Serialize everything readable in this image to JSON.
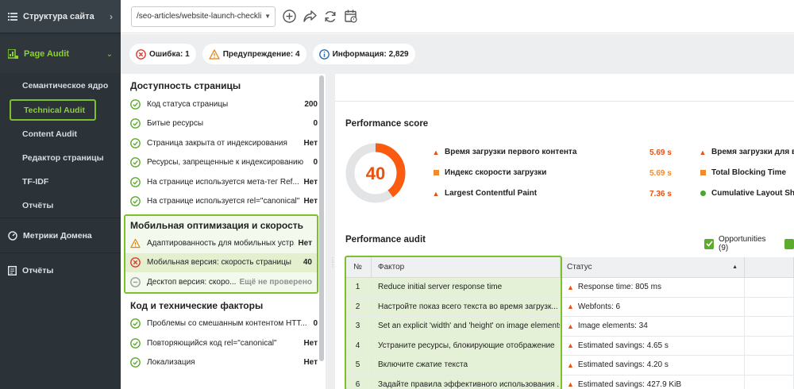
{
  "sidebar": {
    "top_item": "Структура сайта",
    "page_audit": "Page Audit",
    "sub_items": [
      "Семантическое ядро",
      "Technical Audit",
      "Content Audit",
      "Редактор страницы",
      "TF-IDF",
      "Отчёты"
    ],
    "main_items": [
      "Метрики Домена",
      "Отчёты"
    ]
  },
  "toolbar": {
    "url": "/seo-articles/website-launch-checkli..."
  },
  "filters": {
    "errors": "Ошибка: 1",
    "warnings": "Предупреждение: 4",
    "info": "Информация: 2,829"
  },
  "colors": {
    "accent": "#7cc12c",
    "error": "#e8510f",
    "ok": "#5cab2d"
  },
  "availability": {
    "title": "Доступность страницы",
    "rows": [
      {
        "name": "Код статуса страницы",
        "value": "200"
      },
      {
        "name": "Битые ресурсы",
        "value": "0"
      },
      {
        "name": "Страница закрыта от индексирования",
        "value": "Нет"
      },
      {
        "name": "Ресурсы, запрещенные к индексированию",
        "value": "0"
      },
      {
        "name": "На странице используется мета-тег Ref...",
        "value": "Нет"
      },
      {
        "name": "На странице используется rel=\"canonical\"",
        "value": "Нет"
      }
    ]
  },
  "mobile": {
    "title": "Мобильная оптимизация и скорость",
    "rows": [
      {
        "name": "Адаптированность для мобильных устр...",
        "value": "Нет"
      },
      {
        "name": "Мобильная версия: скорость страницы",
        "value": "40"
      },
      {
        "name": "Десктоп версия: скоро...",
        "value": "Ещё не проверено"
      }
    ]
  },
  "code": {
    "title": "Код и технические факторы",
    "rows": [
      {
        "name": "Проблемы со смешанным контентом НТТ...",
        "value": "0"
      },
      {
        "name": "Повторяющийся код rel=\"canonical\"",
        "value": "Нет"
      },
      {
        "name": "Локализация",
        "value": "Нет"
      }
    ]
  },
  "performance": {
    "title": "Performance score",
    "score": "40",
    "score_fraction": 0.4,
    "metrics": [
      {
        "label": "Время загрузки первого контента",
        "value": "5.69 s"
      },
      {
        "label": "Индекс скорости загрузки",
        "value": "5.69 s"
      },
      {
        "label": "Largest Contentful Paint",
        "value": "7.36 s"
      },
      {
        "label": "Время загрузки для взаи"
      },
      {
        "label": "Total Blocking Time"
      },
      {
        "label": "Cumulative Layout Shift"
      }
    ]
  },
  "audit": {
    "title": "Performance audit",
    "opportunities": "Opportunities (9)",
    "columns": [
      "№",
      "Фактор",
      "Статус"
    ],
    "rows": [
      {
        "num": "1",
        "factor": "Reduce initial server response time",
        "status": "Response time: 805 ms"
      },
      {
        "num": "2",
        "factor": "Настройте показ всего текста во время загрузк...",
        "status": "Webfonts: 6"
      },
      {
        "num": "3",
        "factor": "Set an explicit 'width' and 'height' on image elements",
        "status": "Image elements: 34"
      },
      {
        "num": "4",
        "factor": "Устраните ресурсы, блокирующие отображение",
        "status": "Estimated savings: 4.65 s"
      },
      {
        "num": "5",
        "factor": "Включите сжатие текста",
        "status": "Estimated savings: 4.20 s"
      },
      {
        "num": "6",
        "factor": "Задайте правила эффективного использования ...",
        "status": "Estimated savings: 427.9 KiB"
      }
    ]
  }
}
